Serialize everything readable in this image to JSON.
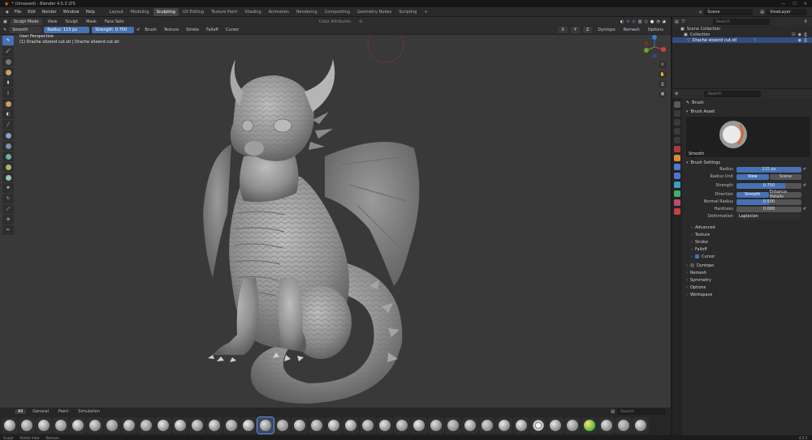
{
  "titlebar": {
    "title": "* (Unsaved) - Blender 4.5.3 LTS"
  },
  "menus": [
    "File",
    "Edit",
    "Render",
    "Window",
    "Help"
  ],
  "workspaces": [
    "Layout",
    "Modeling",
    "Sculpting",
    "UV Editing",
    "Texture Paint",
    "Shading",
    "Animation",
    "Rendering",
    "Compositing",
    "Geometry Nodes",
    "Scripting"
  ],
  "active_workspace": "Sculpting",
  "scene": {
    "label": "Scene",
    "view_layer": "ViewLayer"
  },
  "header1": {
    "mode": "Sculpt Mode",
    "items": [
      "View",
      "Sculpt",
      "Mask",
      "Face Sets"
    ],
    "orientation": "Color Attributes"
  },
  "header2": {
    "brush": "Smooth",
    "radius_label": "Radius",
    "radius_value": "115 px",
    "strength_label": "Strength",
    "strength_value": "0.750",
    "menus": [
      "Brush",
      "Texture",
      "Stroke",
      "Falloff",
      "Cursor"
    ],
    "axes": [
      "X",
      "Y",
      "Z"
    ],
    "right": [
      "Dyntopo",
      "Remesh",
      "Options"
    ]
  },
  "viewport": {
    "perspective": "User Perspective",
    "object": "(1) Drache sitzend cut.stl | Drache sitzend cut.stl"
  },
  "shelf": {
    "tabs": [
      "All",
      "General",
      "Paint",
      "Simulation"
    ],
    "active_tab": "All",
    "search_placeholder": "Search"
  },
  "status": {
    "items": [
      "Sculpt",
      "Rotate View",
      "Remove"
    ],
    "version": "4.5.3"
  },
  "outliner": {
    "search_placeholder": "Search",
    "rows": [
      "Scene Collection",
      "Collection",
      "Drache sitzend cut.stl"
    ]
  },
  "properties": {
    "search_placeholder": "Search",
    "tab_title": "Brush",
    "brush_asset_label": "Brush Asset",
    "brush_asset_name": "Smooth",
    "brush_settings_label": "Brush Settings",
    "radius": {
      "label": "Radius",
      "value": "115 px"
    },
    "radius_unit": {
      "label": "Radius Unit",
      "options": [
        "View",
        "Scene"
      ],
      "selected": "View"
    },
    "strength": {
      "label": "Strength",
      "value": "0.750",
      "fraction": 0.75
    },
    "direction": {
      "label": "Direction",
      "options": [
        "Smooth",
        "Enhance Details"
      ],
      "selected": "Smooth"
    },
    "normal_radius": {
      "label": "Normal Radius",
      "value": "0.500",
      "fraction": 0.5
    },
    "hardness": {
      "label": "Hardness",
      "value": "0.000",
      "fraction": 0.0
    },
    "deformation": {
      "label": "Deformation",
      "value": "Laplacian"
    },
    "subpanels": [
      "Advanced",
      "Texture",
      "Stroke",
      "Falloff",
      "Cursor"
    ],
    "cursor_checked": true,
    "sections": [
      "Dyntopo",
      "Remesh",
      "Symmetry",
      "Options",
      "Workspace"
    ]
  },
  "colors": {
    "accent": "#4772b3",
    "bg": "#393939",
    "panel": "#2a2a2a"
  }
}
